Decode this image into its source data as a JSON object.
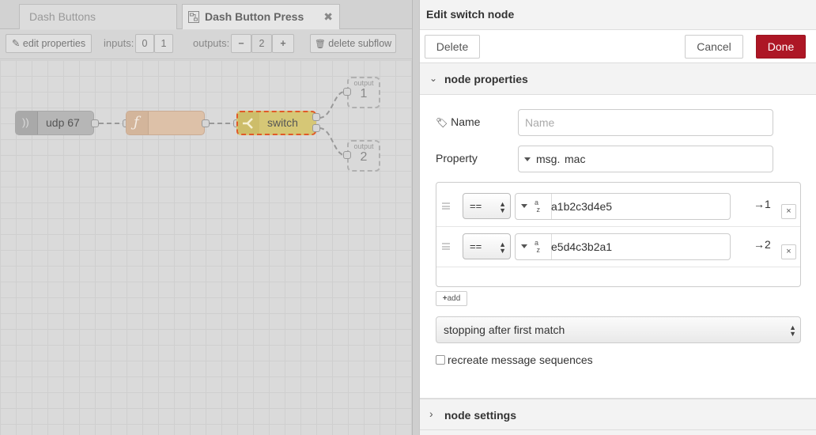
{
  "tabs": [
    {
      "label": "Dash Buttons",
      "active": false
    },
    {
      "label": "Dash Button Press",
      "active": true
    }
  ],
  "subflow_bar": {
    "edit_properties": "edit properties",
    "inputs_label": "inputs:",
    "inputs_options": [
      "0",
      "1"
    ],
    "outputs_label": "outputs:",
    "outputs_minus": "−",
    "outputs_value": "2",
    "outputs_plus": "+",
    "delete_subflow": "delete subflow"
  },
  "flow": {
    "udp_node_label": "udp 67",
    "function_node_icon": "ƒ",
    "switch_node_label": "switch",
    "outputs": [
      {
        "caption": "output",
        "number": "1"
      },
      {
        "caption": "output",
        "number": "2"
      }
    ]
  },
  "editor": {
    "title": "Edit switch node",
    "delete_label": "Delete",
    "cancel_label": "Cancel",
    "done_label": "Done",
    "node_properties_label": "node properties",
    "node_settings_label": "node settings",
    "name_label": "Name",
    "name_placeholder": "Name",
    "property_label": "Property",
    "property_prefix": "msg.",
    "property_value": "mac",
    "rules": [
      {
        "operator": "==",
        "type_icon": "az",
        "value": "a1b2c3d4e5",
        "output": "→1"
      },
      {
        "operator": "==",
        "type_icon": "az",
        "value": "e5d4c3b2a1",
        "output": "→2"
      }
    ],
    "remove_icon": "×",
    "add_label": "add",
    "checking_option": "stopping after first match",
    "recreate_label": "recreate message sequences",
    "recreate_checked": false
  },
  "colors": {
    "done_button": "#ad1625",
    "function_node": "#ddc1a8",
    "switch_node": "#d6c776",
    "switch_selected_border": "#e05a28",
    "udp_node": "#b5b5b5"
  }
}
